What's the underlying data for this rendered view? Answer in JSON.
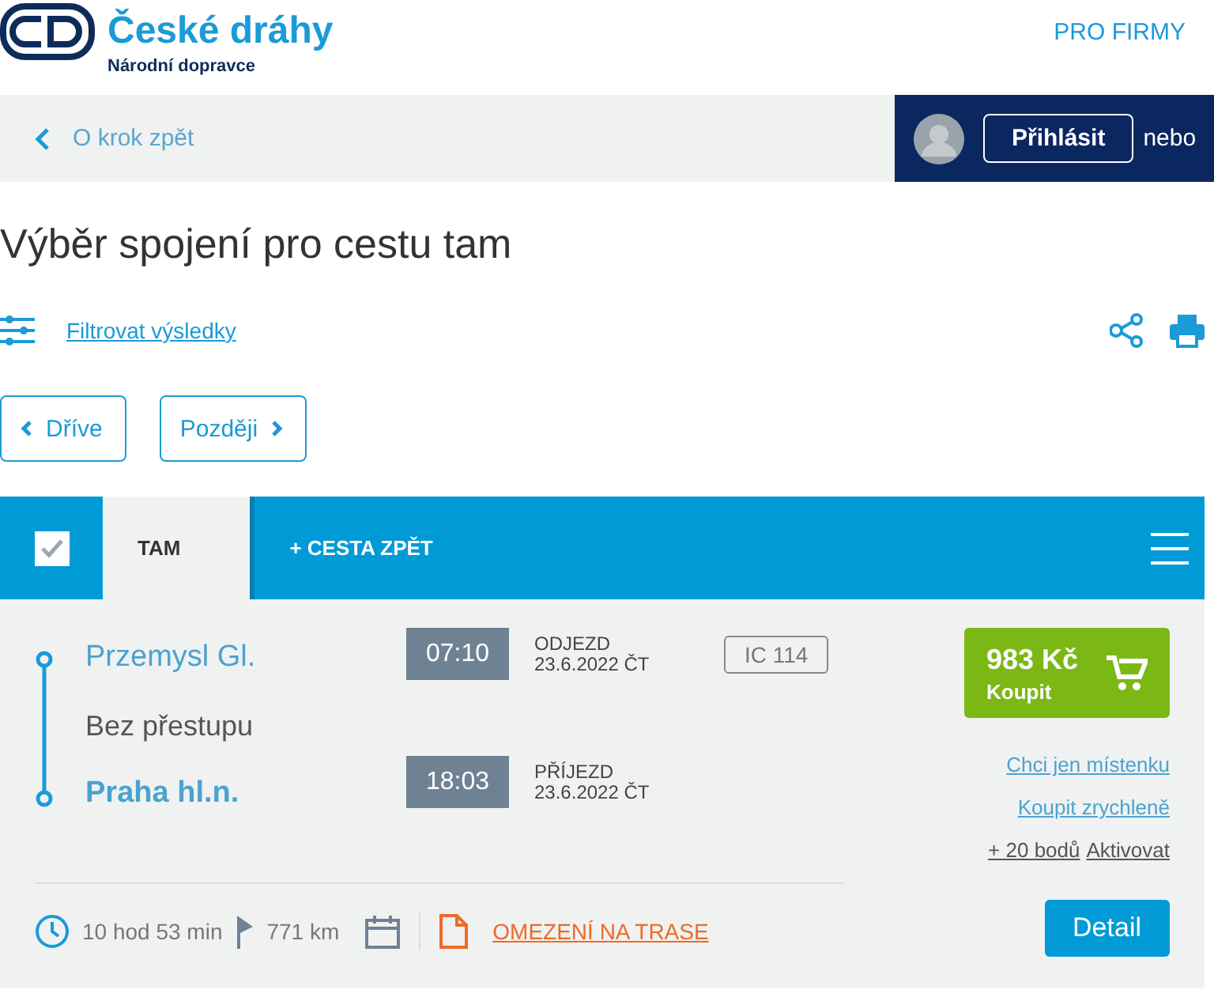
{
  "header": {
    "brand": "České dráhy",
    "tagline": "Národní dopravce",
    "nav_link": "PRO FIRMY"
  },
  "toolbar": {
    "back": "O krok zpět",
    "login_button": "Přihlásit",
    "or_text": "nebo"
  },
  "title": "Výběr spojení pro cestu tam",
  "filter_link": "Filtrovat výsledky",
  "paging": {
    "earlier": "Dříve",
    "later": "Později"
  },
  "select_all": {
    "checked": true
  },
  "tabs": [
    {
      "label": "TAM",
      "selected": true
    },
    {
      "label": "+ CESTA ZPĚT",
      "selected": false
    }
  ],
  "connection": {
    "from": "Przemysl Gl.",
    "to": "Praha hl.n.",
    "transfers": "Bez přestupu",
    "departure": {
      "time": "07:10",
      "label": "ODJEZD",
      "date": "23.6.2022 ČT"
    },
    "arrival": {
      "time": "18:03",
      "label": "PŘÍJEZD",
      "date": "23.6.2022 ČT"
    },
    "train": "IC 114",
    "price": "983 Kč",
    "buy": "Koupit",
    "links": [
      "Chci jen místenku",
      "Koupit zrychleně"
    ],
    "points": "+ 20 bodů",
    "activate": "Aktivovat",
    "duration": "10 hod 53 min",
    "distance": "771 km",
    "restriction": "OMEZENÍ NA TRASE",
    "detail": "Detail"
  }
}
